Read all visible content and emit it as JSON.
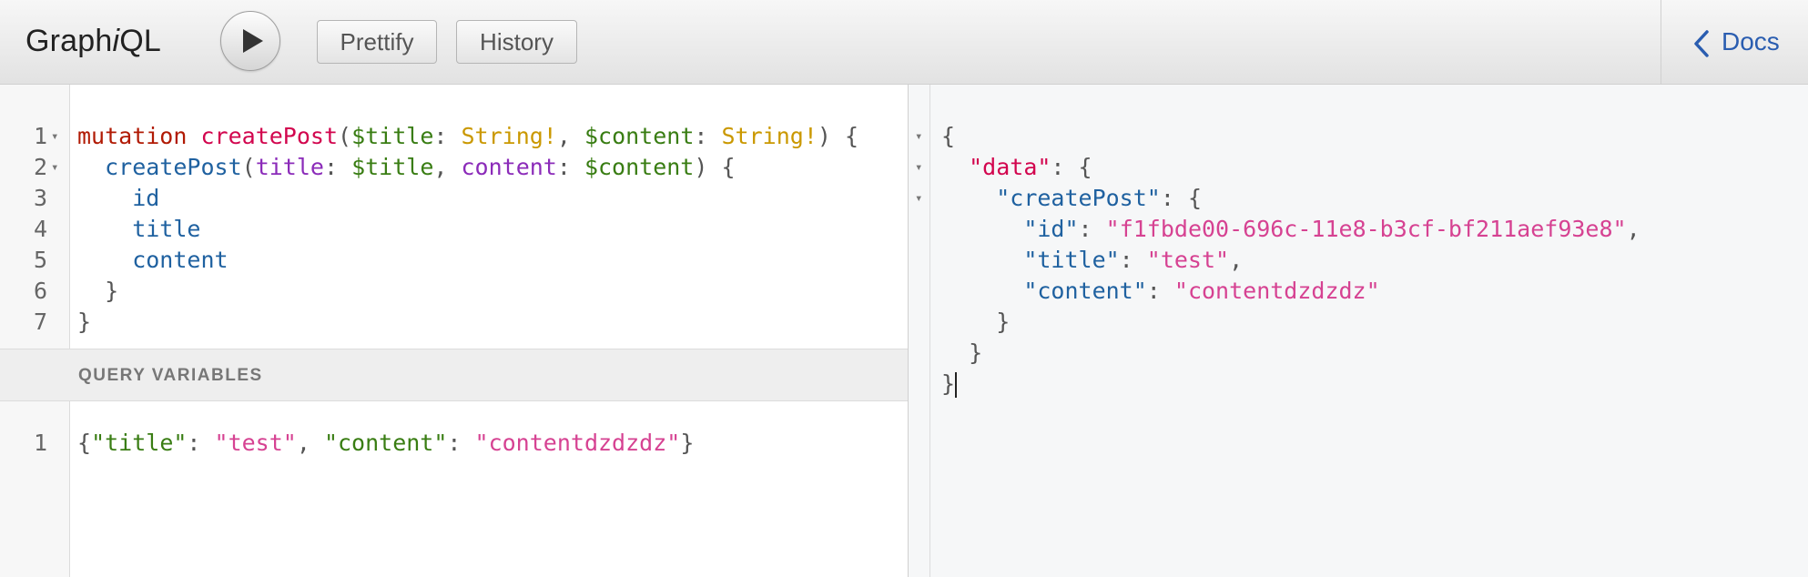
{
  "toolbar": {
    "logo_prefix": "Graph",
    "logo_italic": "i",
    "logo_suffix": "QL",
    "prettify_label": "Prettify",
    "history_label": "History",
    "docs_label": "Docs"
  },
  "query_editor": {
    "line_numbers": [
      "1",
      "2",
      "3",
      "4",
      "5",
      "6",
      "7"
    ],
    "lines": [
      [
        {
          "t": "mutation",
          "c": "kw"
        },
        {
          "t": " ",
          "c": "punc"
        },
        {
          "t": "createPost",
          "c": "def"
        },
        {
          "t": "(",
          "c": "punc"
        },
        {
          "t": "$title",
          "c": "var"
        },
        {
          "t": ": ",
          "c": "punc"
        },
        {
          "t": "String",
          "c": "type"
        },
        {
          "t": "!",
          "c": "type"
        },
        {
          "t": ", ",
          "c": "punc"
        },
        {
          "t": "$content",
          "c": "var"
        },
        {
          "t": ": ",
          "c": "punc"
        },
        {
          "t": "String",
          "c": "type"
        },
        {
          "t": "!",
          "c": "type"
        },
        {
          "t": ") {",
          "c": "punc"
        }
      ],
      [
        {
          "t": "  createPost",
          "c": "prop"
        },
        {
          "t": "(",
          "c": "punc"
        },
        {
          "t": "title",
          "c": "attr"
        },
        {
          "t": ": ",
          "c": "punc"
        },
        {
          "t": "$title",
          "c": "var"
        },
        {
          "t": ", ",
          "c": "punc"
        },
        {
          "t": "content",
          "c": "attr"
        },
        {
          "t": ": ",
          "c": "punc"
        },
        {
          "t": "$content",
          "c": "var"
        },
        {
          "t": ") {",
          "c": "punc"
        }
      ],
      [
        {
          "t": "    id",
          "c": "prop"
        }
      ],
      [
        {
          "t": "    title",
          "c": "prop"
        }
      ],
      [
        {
          "t": "    content",
          "c": "prop"
        }
      ],
      [
        {
          "t": "  }",
          "c": "punc"
        }
      ],
      [
        {
          "t": "}",
          "c": "punc"
        }
      ]
    ],
    "fold_lines": [
      0,
      1
    ]
  },
  "query_variables": {
    "label": "QUERY VARIABLES",
    "line_numbers": [
      "1"
    ],
    "lines": [
      [
        {
          "t": "{",
          "c": "punc"
        },
        {
          "t": "\"title\"",
          "c": "var"
        },
        {
          "t": ": ",
          "c": "punc"
        },
        {
          "t": "\"test\"",
          "c": "str"
        },
        {
          "t": ", ",
          "c": "punc"
        },
        {
          "t": "\"content\"",
          "c": "var"
        },
        {
          "t": ": ",
          "c": "punc"
        },
        {
          "t": "\"contentdzdzdz\"",
          "c": "str"
        },
        {
          "t": "}",
          "c": "punc"
        }
      ]
    ]
  },
  "result_viewer": {
    "lines": [
      [
        {
          "t": "{",
          "c": "punc"
        }
      ],
      [
        {
          "t": "  ",
          "c": "punc"
        },
        {
          "t": "\"data\"",
          "c": "def"
        },
        {
          "t": ": {",
          "c": "punc"
        }
      ],
      [
        {
          "t": "    ",
          "c": "punc"
        },
        {
          "t": "\"createPost\"",
          "c": "key"
        },
        {
          "t": ": {",
          "c": "punc"
        }
      ],
      [
        {
          "t": "      ",
          "c": "punc"
        },
        {
          "t": "\"id\"",
          "c": "key"
        },
        {
          "t": ": ",
          "c": "punc"
        },
        {
          "t": "\"f1fbde00-696c-11e8-b3cf-bf211aef93e8\"",
          "c": "str"
        },
        {
          "t": ",",
          "c": "punc"
        }
      ],
      [
        {
          "t": "      ",
          "c": "punc"
        },
        {
          "t": "\"title\"",
          "c": "key"
        },
        {
          "t": ": ",
          "c": "punc"
        },
        {
          "t": "\"test\"",
          "c": "str"
        },
        {
          "t": ",",
          "c": "punc"
        }
      ],
      [
        {
          "t": "      ",
          "c": "punc"
        },
        {
          "t": "\"content\"",
          "c": "key"
        },
        {
          "t": ": ",
          "c": "punc"
        },
        {
          "t": "\"contentdzdzdz\"",
          "c": "str"
        }
      ],
      [
        {
          "t": "    }",
          "c": "punc"
        }
      ],
      [
        {
          "t": "  }",
          "c": "punc"
        }
      ],
      [
        {
          "t": "}",
          "c": "punc"
        }
      ]
    ],
    "fold_lines": [
      0,
      1,
      2
    ]
  },
  "icons": {
    "run": "play-icon",
    "docs": "chevron-left-icon",
    "fold": "fold-arrow-icon"
  },
  "colors": {
    "keyword": "#b11a04",
    "definition": "#d2054e",
    "variable": "#397d13",
    "type": "#ca9800",
    "property": "#1f61a0",
    "attribute": "#8b2bb9",
    "string": "#d64292",
    "docs_link": "#2a5db0"
  }
}
